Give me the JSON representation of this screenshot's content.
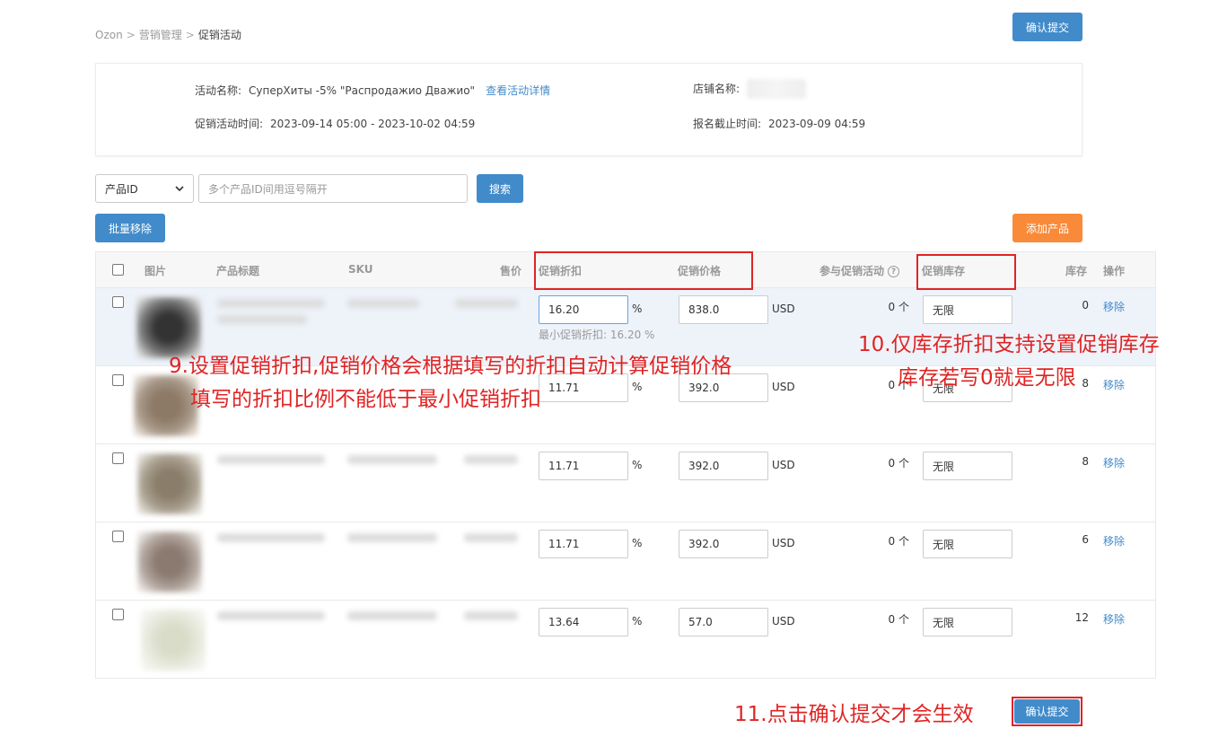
{
  "breadcrumb": {
    "items": [
      "Ozon",
      "营销管理",
      "促销活动"
    ]
  },
  "header": {
    "confirm_label": "确认提交"
  },
  "info": {
    "activity_name_label": "活动名称:",
    "activity_name": "СуперХиты -5% \"Распродажио Дважио\"",
    "view_detail_link": "查看活动详情",
    "shop_name_label": "店铺名称:",
    "time_label": "促销活动时间:",
    "time_value": "2023-09-14 05:00 - 2023-10-02 04:59",
    "deadline_label": "报名截止时间:",
    "deadline_value": "2023-09-09 04:59"
  },
  "search": {
    "select_value": "产品ID",
    "input_placeholder": "多个产品ID间用逗号隔开",
    "button_label": "搜索"
  },
  "actions": {
    "batch_remove_label": "批量移除",
    "add_product_label": "添加产品"
  },
  "table": {
    "headers": {
      "image": "图片",
      "title": "产品标题",
      "sku": "SKU",
      "price": "售价",
      "discount": "促销折扣",
      "promo_price": "促销价格",
      "joined": "参与促销活动",
      "promo_stock": "促销库存",
      "stock": "库存",
      "op": "操作"
    },
    "min_discount_hint": "最小促销折扣: 16.20 %",
    "percent_unit": "%",
    "currency": "USD",
    "remove_label": "移除",
    "rows": [
      {
        "discount": "16.20",
        "price": "838.0",
        "joined": "0 个",
        "promo_stock": "无限",
        "stock": "0"
      },
      {
        "discount": "11.71",
        "price": "392.0",
        "joined": "0 个",
        "promo_stock": "无限",
        "stock": "8"
      },
      {
        "discount": "11.71",
        "price": "392.0",
        "joined": "0 个",
        "promo_stock": "无限",
        "stock": "8"
      },
      {
        "discount": "11.71",
        "price": "392.0",
        "joined": "0 个",
        "promo_stock": "无限",
        "stock": "6"
      },
      {
        "discount": "13.64",
        "price": "57.0",
        "joined": "0 个",
        "promo_stock": "无限",
        "stock": "12"
      }
    ]
  },
  "annotations": {
    "step9_line1": "9.设置促销折扣,促销价格会根据填写的折扣自动计算促销价格",
    "step9_line2": "填写的折扣比例不能低于最小促销折扣",
    "step10_line1": "10.仅库存折扣支持设置促销库存",
    "step10_line2": "库存若写0就是无限",
    "step11": "11.点击确认提交才会生效"
  },
  "colors": {
    "primary": "#428bca",
    "orange": "#f98a3a",
    "annotation_red": "#e02424"
  }
}
